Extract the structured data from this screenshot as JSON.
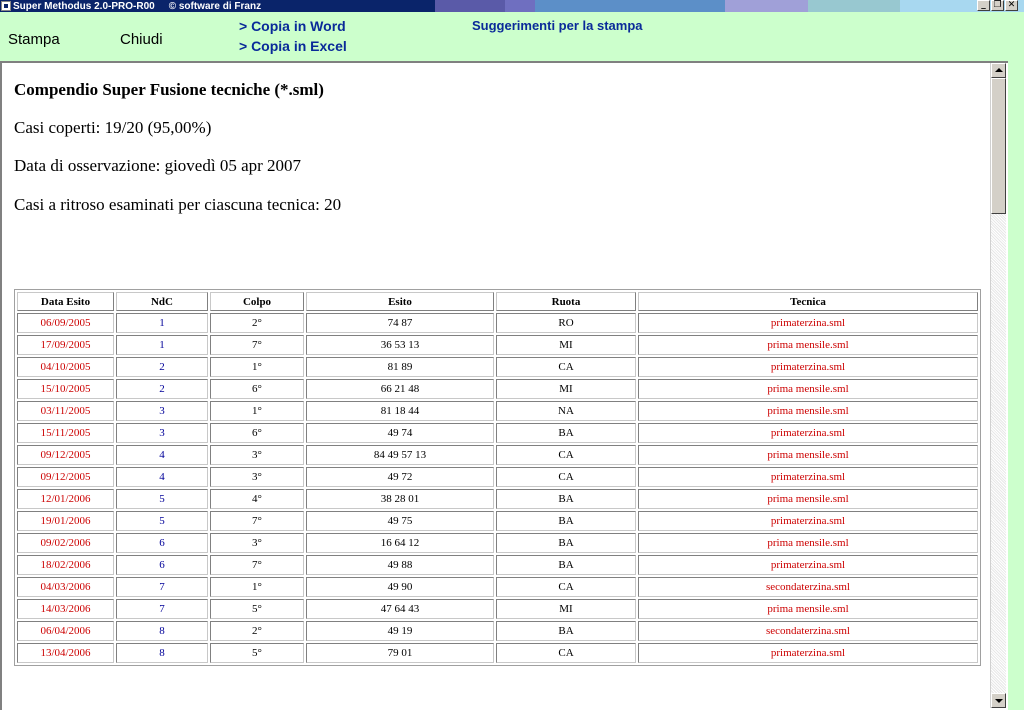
{
  "window": {
    "title": "Super Methodus 2.0-PRO-R00",
    "copyright": "© software di Franz",
    "title_segments": [
      "#5a5aa8",
      "#6f6fc0",
      "#5c8fc8",
      "#8fa6d0",
      "#a0a0d8",
      "#98c8d0",
      "#a8d8f0"
    ]
  },
  "toolbar": {
    "print_label": "Stampa",
    "close_label": "Chiudi",
    "copy_word_label": "> Copia in Word",
    "copy_excel_label": "> Copia in Excel",
    "print_tips_label": "Suggerimenti per la stampa"
  },
  "report": {
    "title": "Compendio Super Fusione tecniche (*.sml)",
    "covered": "Casi coperti: 19/20 (95,00%)",
    "date": "Data di osservazione: giovedì 05 apr 2007",
    "cases": "Casi a ritroso esaminati per ciascuna tecnica: 20"
  },
  "table": {
    "headers": [
      "Data Esito",
      "NdC",
      "Colpo",
      "Esito",
      "Ruota",
      "Tecnica"
    ],
    "rows": [
      [
        "06/09/2005",
        "1",
        "2°",
        "74 87",
        "RO",
        "primaterzina.sml"
      ],
      [
        "17/09/2005",
        "1",
        "7°",
        "36 53 13",
        "MI",
        "prima mensile.sml"
      ],
      [
        "04/10/2005",
        "2",
        "1°",
        "81 89",
        "CA",
        "primaterzina.sml"
      ],
      [
        "15/10/2005",
        "2",
        "6°",
        "66 21 48",
        "MI",
        "prima mensile.sml"
      ],
      [
        "03/11/2005",
        "3",
        "1°",
        "81 18 44",
        "NA",
        "prima mensile.sml"
      ],
      [
        "15/11/2005",
        "3",
        "6°",
        "49 74",
        "BA",
        "primaterzina.sml"
      ],
      [
        "09/12/2005",
        "4",
        "3°",
        "84 49 57 13",
        "CA",
        "prima mensile.sml"
      ],
      [
        "09/12/2005",
        "4",
        "3°",
        "49 72",
        "CA",
        "primaterzina.sml"
      ],
      [
        "12/01/2006",
        "5",
        "4°",
        "38 28 01",
        "BA",
        "prima mensile.sml"
      ],
      [
        "19/01/2006",
        "5",
        "7°",
        "49 75",
        "BA",
        "primaterzina.sml"
      ],
      [
        "09/02/2006",
        "6",
        "3°",
        "16 64 12",
        "BA",
        "prima mensile.sml"
      ],
      [
        "18/02/2006",
        "6",
        "7°",
        "49 88",
        "BA",
        "primaterzina.sml"
      ],
      [
        "04/03/2006",
        "7",
        "1°",
        "49 90",
        "CA",
        "secondaterzina.sml"
      ],
      [
        "14/03/2006",
        "7",
        "5°",
        "47 64 43",
        "MI",
        "prima mensile.sml"
      ],
      [
        "06/04/2006",
        "8",
        "2°",
        "49 19",
        "BA",
        "secondaterzina.sml"
      ],
      [
        "13/04/2006",
        "8",
        "5°",
        "79 01",
        "CA",
        "primaterzina.sml"
      ]
    ]
  }
}
